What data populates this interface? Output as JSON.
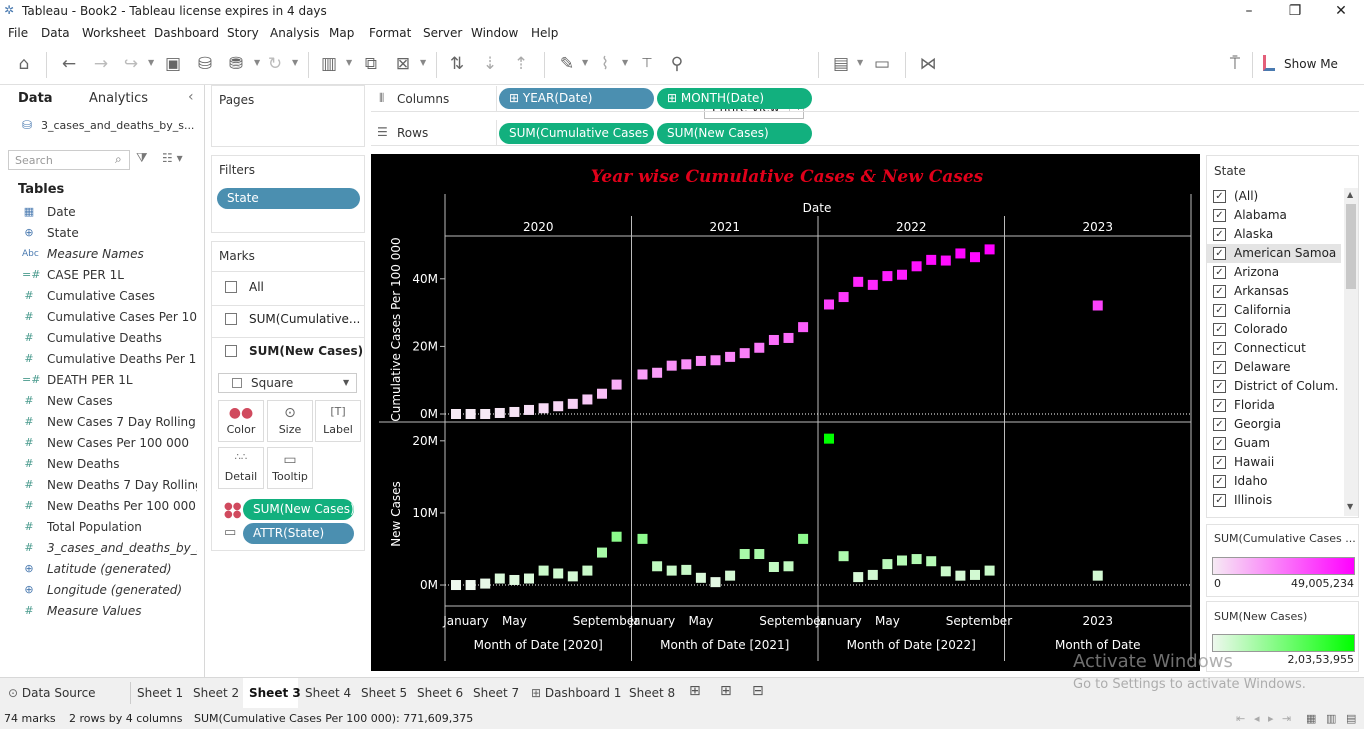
{
  "window": {
    "title": "Tableau - Book2 - Tableau license expires in 4 days"
  },
  "menu": [
    "File",
    "Data",
    "Worksheet",
    "Dashboard",
    "Story",
    "Analysis",
    "Map",
    "Format",
    "Server",
    "Window",
    "Help"
  ],
  "toolbar": {
    "view_select": "Entire View",
    "show_me": "Show Me"
  },
  "data_pane": {
    "tab_data": "Data",
    "tab_analytics": "Analytics",
    "datasource": "3_cases_and_deaths_by_s...",
    "search_placeholder": "Search",
    "tables_heading": "Tables",
    "fields": [
      {
        "icon": "date-icon",
        "glyph": "▦",
        "label": "Date",
        "italic": false
      },
      {
        "icon": "globe-icon",
        "glyph": "⊕",
        "label": "State",
        "italic": false
      },
      {
        "icon": "abc-icon",
        "glyph": "Abc",
        "label": "Measure Names",
        "italic": true
      },
      {
        "icon": "calc-measure-icon",
        "glyph": "=#",
        "label": "CASE PER 1L",
        "italic": false
      },
      {
        "icon": "measure-icon",
        "glyph": "#",
        "label": "Cumulative Cases",
        "italic": false
      },
      {
        "icon": "measure-icon",
        "glyph": "#",
        "label": "Cumulative Cases Per 100 ...",
        "italic": false
      },
      {
        "icon": "measure-icon",
        "glyph": "#",
        "label": "Cumulative Deaths",
        "italic": false
      },
      {
        "icon": "measure-icon",
        "glyph": "#",
        "label": "Cumulative Deaths Per 10...",
        "italic": false
      },
      {
        "icon": "calc-measure-icon",
        "glyph": "=#",
        "label": "DEATH PER 1L",
        "italic": false
      },
      {
        "icon": "measure-icon",
        "glyph": "#",
        "label": "New Cases",
        "italic": false
      },
      {
        "icon": "measure-icon",
        "glyph": "#",
        "label": "New Cases 7 Day Rolling ...",
        "italic": false
      },
      {
        "icon": "measure-icon",
        "glyph": "#",
        "label": "New Cases Per 100 000",
        "italic": false
      },
      {
        "icon": "measure-icon",
        "glyph": "#",
        "label": "New Deaths",
        "italic": false
      },
      {
        "icon": "measure-icon",
        "glyph": "#",
        "label": "New Deaths 7 Day Rolling ...",
        "italic": false
      },
      {
        "icon": "measure-icon",
        "glyph": "#",
        "label": "New Deaths Per 100 000",
        "italic": false
      },
      {
        "icon": "measure-icon",
        "glyph": "#",
        "label": "Total Population",
        "italic": false
      },
      {
        "icon": "measure-icon",
        "glyph": "#",
        "label": "3_cases_and_deaths_by_st...",
        "italic": true
      },
      {
        "icon": "globe-icon",
        "glyph": "⊕",
        "label": "Latitude (generated)",
        "italic": true
      },
      {
        "icon": "globe-icon",
        "glyph": "⊕",
        "label": "Longitude (generated)",
        "italic": true
      },
      {
        "icon": "measure-icon",
        "glyph": "#",
        "label": "Measure Values",
        "italic": true
      }
    ]
  },
  "cards": {
    "pages": "Pages",
    "filters": "Filters",
    "filter_pill": "State",
    "marks": "Marks",
    "marks_all": "All",
    "marks_cum": "SUM(Cumulative...",
    "marks_new": "SUM(New Cases)",
    "mark_type": "Square",
    "buttons": {
      "color": "Color",
      "size": "Size",
      "label": "Label",
      "detail": "Detail",
      "tooltip": "Tooltip"
    },
    "color_pill": "SUM(New Cases)",
    "detail_pill": "ATTR(State)"
  },
  "shelves": {
    "columns_label": "Columns",
    "rows_label": "Rows",
    "col1": "YEAR(Date)",
    "col2": "MONTH(Date)",
    "row1": "SUM(Cumulative Cases ..",
    "row2": "SUM(New Cases)"
  },
  "state_filter": {
    "title": "State",
    "items": [
      "(All)",
      "Alabama",
      "Alaska",
      "American Samoa",
      "Arizona",
      "Arkansas",
      "California",
      "Colorado",
      "Connecticut",
      "Delaware",
      "District of Colum...",
      "Florida",
      "Georgia",
      "Guam",
      "Hawaii",
      "Idaho",
      "Illinois"
    ],
    "highlighted": "American Samoa"
  },
  "legends": {
    "cum_title": "SUM(Cumulative Cases ...",
    "cum_min": "0",
    "cum_max": "49,005,234",
    "new_title": "SUM(New Cases)",
    "new_max": "2,03,53,955",
    "cum_color": "#ff00ff",
    "new_color": "#00ff00"
  },
  "tabs": {
    "data_source": "Data Source",
    "sheets": [
      "Sheet 1",
      "Sheet 2",
      "Sheet 3",
      "Sheet 4",
      "Sheet 5",
      "Sheet 6",
      "Sheet 7",
      "Dashboard 1",
      "Sheet 8"
    ],
    "active": "Sheet 3"
  },
  "status": {
    "marks": "74 marks",
    "dims": "2 rows by 4 columns",
    "sum": "SUM(Cumulative Cases Per 100 000): 771,609,375"
  },
  "watermark": {
    "line1": "Activate Windows",
    "line2": "Go to Settings to activate Windows."
  },
  "chart_data": {
    "type": "scatter",
    "title": "Year wise Cumulative Cases & New Cases",
    "column_header": "Date",
    "years": [
      "2020",
      "2021",
      "2022",
      "2023"
    ],
    "xlabels": [
      "Month of Date [2020]",
      "Month of Date [2021]",
      "Month of Date [2022]",
      "Month of Date"
    ],
    "month_ticks": [
      [
        "January",
        "May",
        "September"
      ],
      [
        "January",
        "May",
        "September"
      ],
      [
        "January",
        "May",
        "September"
      ],
      [
        "2023"
      ]
    ],
    "series": [
      {
        "name": "Cumulative Cases Per 100 000",
        "ylabel": "Cumulative Cases Per 100 000",
        "ylim": [
          0,
          50000000
        ],
        "ticks": [
          "0M",
          "20M",
          "40M"
        ],
        "tick_values": [
          0,
          20000000,
          40000000
        ],
        "values": [
          [
            0,
            0,
            0,
            0.3,
            0.6,
            1.2,
            1.7,
            2.3,
            3.0,
            4.3,
            6.0,
            8.7
          ],
          [
            11.7,
            12.2,
            14.3,
            14.7,
            15.7,
            15.9,
            16.9,
            18.0,
            19.6,
            21.9,
            22.5,
            25.7
          ],
          [
            32.4,
            34.6,
            39.1,
            38.2,
            40.8,
            41.2,
            43.7,
            45.6,
            45.4,
            47.5,
            46.4,
            48.7
          ],
          [
            32.1
          ]
        ]
      },
      {
        "name": "New Cases",
        "ylabel": "New Cases",
        "ylim": [
          -1800000,
          21500000
        ],
        "ticks": [
          "0M",
          "10M",
          "20M"
        ],
        "tick_values": [
          0,
          10000000,
          20000000
        ],
        "values": [
          [
            0,
            0,
            0.2,
            0.9,
            0.7,
            0.9,
            2.0,
            1.6,
            1.2,
            2.0,
            4.5,
            6.7
          ],
          [
            6.4,
            2.6,
            2.0,
            2.1,
            1.0,
            0.4,
            1.3,
            4.3,
            4.3,
            2.5,
            2.6,
            6.4
          ],
          [
            20.3,
            4.0,
            1.1,
            1.4,
            2.9,
            3.4,
            3.6,
            3.3,
            1.9,
            1.3,
            1.4,
            2.0
          ],
          [
            1.3
          ]
        ]
      }
    ]
  }
}
